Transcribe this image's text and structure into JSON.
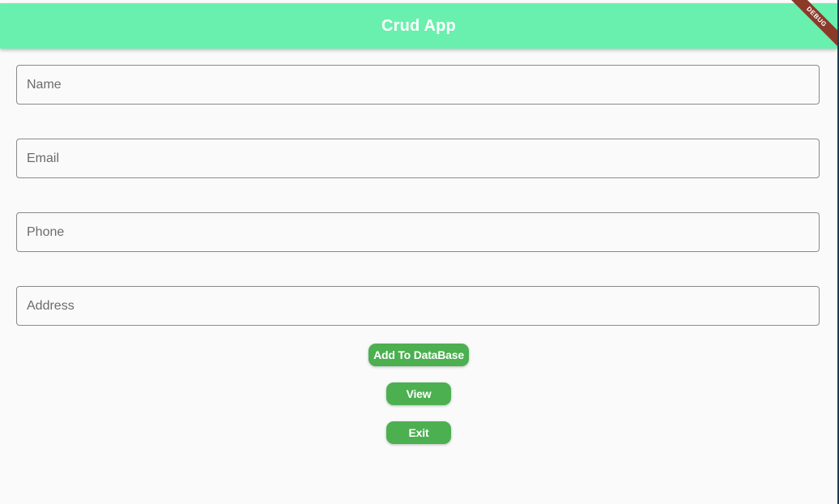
{
  "app_bar": {
    "title": "Crud App",
    "color": "#69f0ae",
    "debug_label": "DEBUG"
  },
  "form": {
    "fields": [
      {
        "placeholder": "Name",
        "value": ""
      },
      {
        "placeholder": "Email",
        "value": ""
      },
      {
        "placeholder": "Phone",
        "value": ""
      },
      {
        "placeholder": "Address",
        "value": ""
      }
    ]
  },
  "buttons": {
    "add_label": "Add To DataBase",
    "view_label": "View",
    "exit_label": "Exit",
    "color": "#4caf50"
  }
}
